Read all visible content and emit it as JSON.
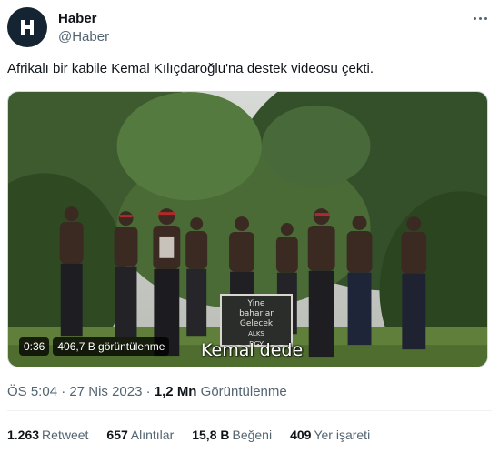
{
  "account": {
    "name": "Haber",
    "handle": "@Haber",
    "avatar_color": "#152433"
  },
  "tweet": {
    "text": "Afrikalı bir kabile Kemal Kılıçdaroğlu'na destek videosu çekti."
  },
  "video": {
    "duration": "0:36",
    "views_badge": "406,7 B görüntülenme",
    "subtitle": "Kemal dede",
    "sign_lines": [
      "Yine",
      "baharlar",
      "Gelecek",
      "ALKS",
      "BGY"
    ]
  },
  "meta": {
    "time": "ÖS 5:04",
    "separator": "·",
    "date": "27 Nis 2023",
    "views_count": "1,2 Mn",
    "views_label": "Görüntülenme"
  },
  "stats": {
    "retweets_count": "1.263",
    "retweets_label": "Retweet",
    "quotes_count": "657",
    "quotes_label": "Alıntılar",
    "likes_count": "15,8 B",
    "likes_label": "Beğeni",
    "bookmarks_count": "409",
    "bookmarks_label": "Yer işareti"
  },
  "icons": {
    "more": "more-dots-icon",
    "logo": "haber-h-logo-icon"
  }
}
